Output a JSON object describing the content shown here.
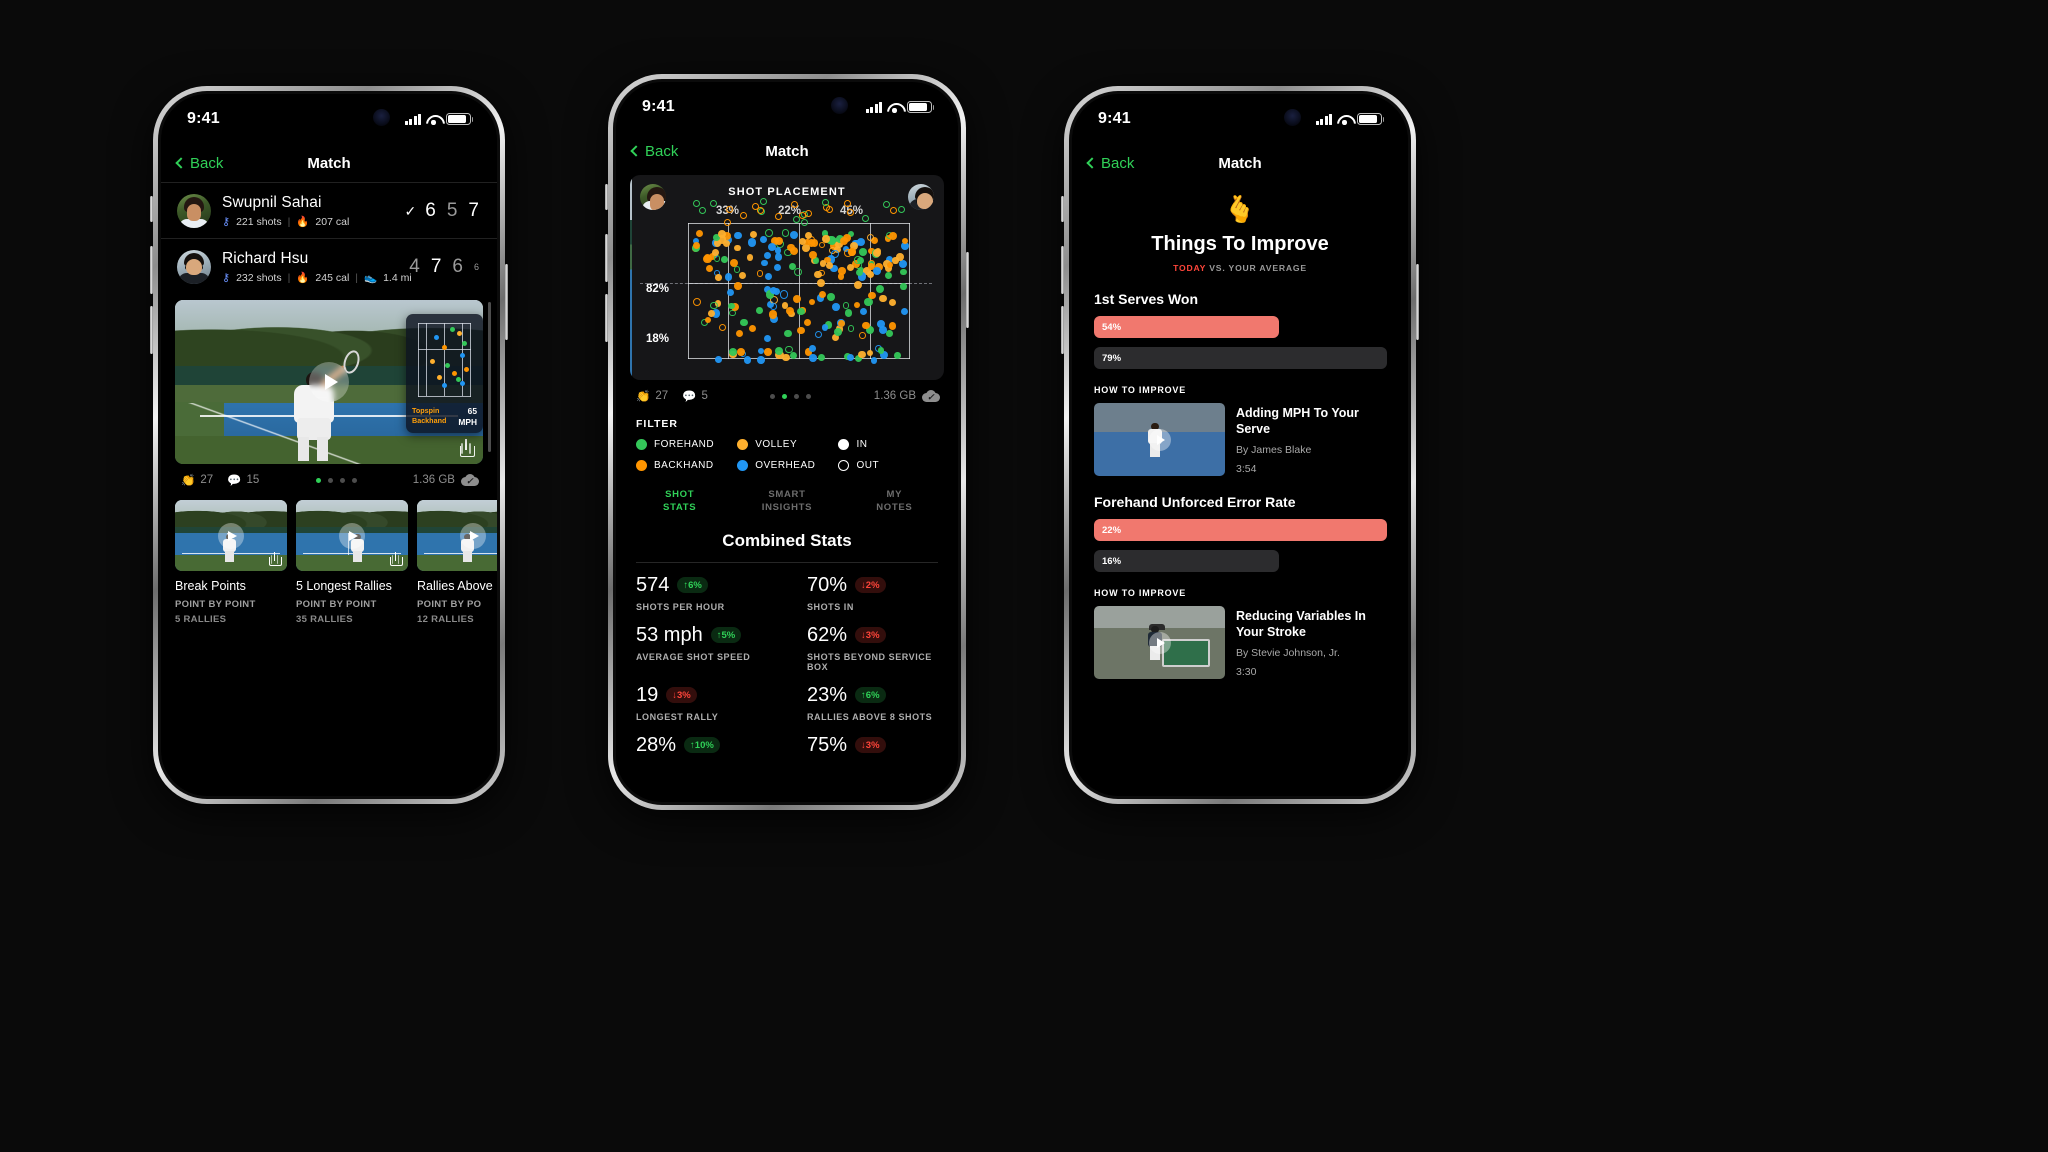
{
  "status_bar": {
    "time": "9:41"
  },
  "nav": {
    "back_label": "Back",
    "title": "Match"
  },
  "phone1": {
    "players": [
      {
        "name": "Swupnil Sahai",
        "shots": "221 shots",
        "calories": "207 cal",
        "distance": "",
        "won": "✓",
        "sets": [
          "6",
          "5",
          "7"
        ],
        "tiebreak": ""
      },
      {
        "name": "Richard Hsu",
        "shots": "232 shots",
        "calories": "245 cal",
        "distance": "1.4 mi",
        "won": "",
        "sets": [
          "4",
          "7",
          "6"
        ],
        "tiebreak": "6"
      }
    ],
    "hero_video": {
      "overlay_shot": "Topspin Backhand",
      "overlay_speed_value": "65",
      "overlay_speed_unit": "MPH"
    },
    "meta": {
      "claps": "27",
      "comments": "15",
      "size": "1.36 GB",
      "page_index": 0,
      "page_count": 4
    },
    "thumbnails": [
      {
        "title": "Break Points",
        "subtitle": "POINT BY POINT",
        "detail": "5 RALLIES"
      },
      {
        "title": "5 Longest Rallies",
        "subtitle": "POINT BY POINT",
        "detail": "35 RALLIES"
      },
      {
        "title": "Rallies Above",
        "subtitle": "POINT BY PO",
        "detail": "12 RALLIES"
      }
    ]
  },
  "phone2": {
    "shot_placement": {
      "title": "SHOT PLACEMENT",
      "top_percents": [
        "33%",
        "22%",
        "45%"
      ],
      "left_percents": [
        "82%",
        "18%"
      ]
    },
    "meta": {
      "claps": "27",
      "comments": "5",
      "size": "1.36 GB",
      "page_index": 1,
      "page_count": 4
    },
    "filter": {
      "heading": "FILTER",
      "items": [
        {
          "label": "FOREHAND",
          "color": "#34c759",
          "style": "solid"
        },
        {
          "label": "VOLLEY",
          "color": "#ffb02e",
          "style": "solid"
        },
        {
          "label": "IN",
          "color": "#ffffff",
          "style": "solid"
        },
        {
          "label": "BACKHAND",
          "color": "#ff9500",
          "style": "solid"
        },
        {
          "label": "OVERHEAD",
          "color": "#2196f3",
          "style": "solid"
        },
        {
          "label": "OUT",
          "color": "#ffffff",
          "style": "hollow"
        }
      ]
    },
    "tabs": [
      {
        "label": "SHOT\nSTATS",
        "line1": "SHOT",
        "line2": "STATS",
        "active": true
      },
      {
        "label": "SMART\nINSIGHTS",
        "line1": "SMART",
        "line2": "INSIGHTS",
        "active": false
      },
      {
        "label": "MY\nNOTES",
        "line1": "MY",
        "line2": "NOTES",
        "active": false
      }
    ],
    "combined_stats": {
      "title": "Combined Stats",
      "items": [
        {
          "value": "574",
          "delta": "↑6%",
          "dir": "up",
          "label": "SHOTS PER HOUR"
        },
        {
          "value": "70%",
          "delta": "↓2%",
          "dir": "down",
          "label": "SHOTS IN"
        },
        {
          "value": "53 mph",
          "delta": "↑5%",
          "dir": "up",
          "label": "AVERAGE SHOT SPEED"
        },
        {
          "value": "62%",
          "delta": "↓3%",
          "dir": "down",
          "label": "SHOTS BEYOND SERVICE BOX"
        },
        {
          "value": "19",
          "delta": "↓3%",
          "dir": "down",
          "label": "LONGEST RALLY"
        },
        {
          "value": "23%",
          "delta": "↑6%",
          "dir": "up",
          "label": "RALLIES ABOVE 8 SHOTS"
        },
        {
          "value": "28%",
          "delta": "↑10%",
          "dir": "up",
          "label": ""
        },
        {
          "value": "75%",
          "delta": "↓3%",
          "dir": "down",
          "label": ""
        }
      ]
    }
  },
  "phone3": {
    "header": {
      "icon": "hand-clap-icon",
      "title": "Things To Improve",
      "subtitle_highlight": "TODAY",
      "subtitle_rest": " VS. YOUR AVERAGE"
    },
    "improvements": [
      {
        "name": "1st Serves Won",
        "today_value": "54%",
        "today_width": 49,
        "average_value": "79%",
        "average_width": 100,
        "how_to_improve_label": "HOW TO IMPROVE",
        "lesson": {
          "title": "Adding MPH To Your Serve",
          "by": "By James Blake",
          "duration": "3:54"
        }
      },
      {
        "name": "Forehand Unforced Error Rate",
        "today_value": "22%",
        "today_width": 100,
        "average_value": "16%",
        "average_width": 63,
        "how_to_improve_label": "HOW TO IMPROVE",
        "lesson": {
          "title": "Reducing Variables In Your Stroke",
          "by": "By Stevie Johnson, Jr.",
          "duration": "3:30"
        }
      }
    ]
  },
  "chart_data": {
    "type": "scatter",
    "title": "SHOT PLACEMENT",
    "xlabel": "",
    "ylabel": "",
    "grid": true,
    "legend_position": "below",
    "zone_percents": {
      "top": [
        "33%",
        "22%",
        "45%"
      ],
      "left": [
        "82%",
        "18%"
      ]
    },
    "series": [
      {
        "name": "FOREHAND",
        "color": "#34c759"
      },
      {
        "name": "BACKHAND",
        "color": "#ff9500"
      },
      {
        "name": "VOLLEY",
        "color": "#ffb02e"
      },
      {
        "name": "OVERHEAD",
        "color": "#2196f3"
      }
    ]
  }
}
